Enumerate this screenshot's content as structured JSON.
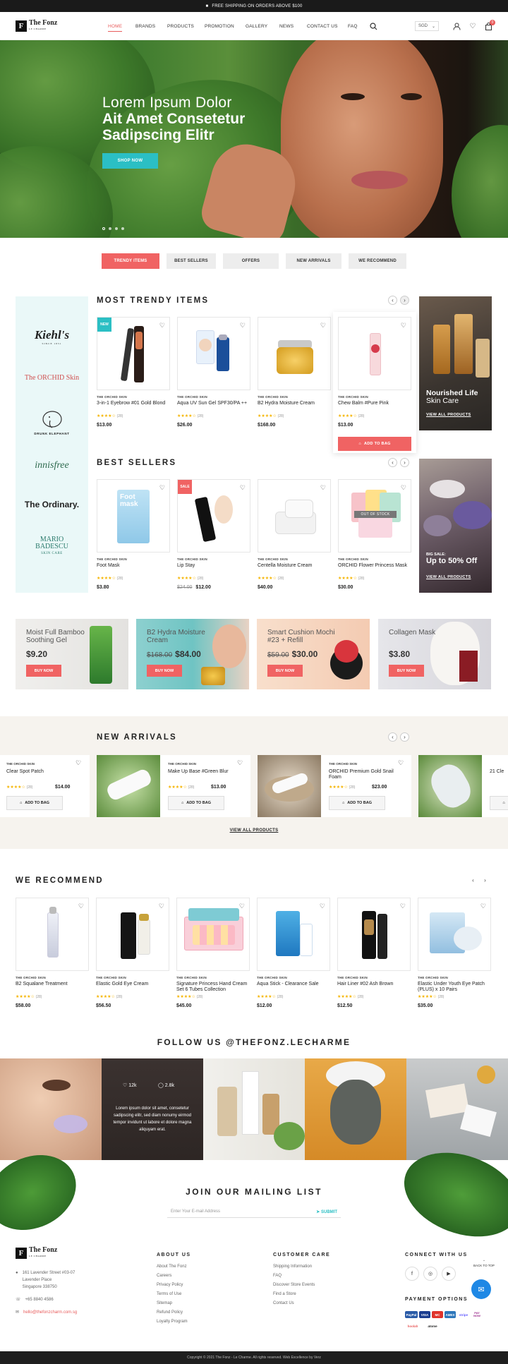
{
  "topbar": {
    "text": "FREE SHIPPING ON ORDERS ABOVE $100"
  },
  "logo": {
    "name": "The Fonz",
    "sub": "LE CHARME"
  },
  "nav": [
    "HOME",
    "BRANDS",
    "PRODUCTS",
    "PROMOTION",
    "GALLERY",
    "NEWS",
    "CONTACT US",
    "FAQ"
  ],
  "currency": "SGD",
  "cart_count": "0",
  "hero": {
    "line1": "Lorem Ipsum Dolor",
    "line2": "Ait Amet Consetetur",
    "line3": "Sadipscing Elitr",
    "button": "SHOP NOW"
  },
  "tabs": [
    "TRENDY ITEMS",
    "BEST SELLERS",
    "OFFERS",
    "NEW ARRIVALS",
    "WE RECOMMEND"
  ],
  "brands": [
    "Kiehl's",
    "The ORCHID Skin",
    "DRUNK ELEPHANT",
    "innisfree",
    "The Ordinary.",
    "MARIO BADESCU"
  ],
  "brand_subs": {
    "kiehls": "SINCE 1851",
    "mario": "SKIN CARE"
  },
  "trendy": {
    "title": "MOST TRENDY ITEMS",
    "items": [
      {
        "tag": "NEW",
        "brand": "THE ORCHID SKIN",
        "name": "3-in-1 Eyebrow #01 Gold Blond",
        "reviews": "(28)",
        "price": "$13.00"
      },
      {
        "brand": "THE ORCHID SKIN",
        "name": "Aqua UV Sun Gel SPF30/PA ++",
        "reviews": "(28)",
        "price": "$26.00"
      },
      {
        "brand": "THE ORCHID SKIN",
        "name": "B2 Hydra Moisture Cream",
        "reviews": "(28)",
        "price": "$168.00"
      },
      {
        "brand": "THE ORCHID SKIN",
        "name": "Chew Balm #Pure Pink",
        "reviews": "(28)",
        "price": "$13.00",
        "button": "ADD TO BAG"
      }
    ],
    "promo": {
      "l1": "Nourished Life",
      "l2": "Skin Care",
      "link": "VIEW ALL PRODUCTS"
    }
  },
  "bestsellers": {
    "title": "BEST SELLERS",
    "items": [
      {
        "brand": "THE ORCHID SKIN",
        "name": "Foot Mask",
        "reviews": "(28)",
        "price": "$3.80"
      },
      {
        "tag": "SALE",
        "brand": "THE ORCHID SKIN",
        "name": "Lip Stay",
        "reviews": "(28)",
        "old": "$24.00",
        "price": "$12.00"
      },
      {
        "brand": "THE ORCHID SKIN",
        "name": "Centella Moisture Cream",
        "reviews": "(28)",
        "price": "$40.00"
      },
      {
        "oos": "OUT OF STOCK",
        "brand": "THE ORCHID SKIN",
        "name": "ORCHID Flower Princess Mask",
        "reviews": "(28)",
        "price": "$30.00"
      }
    ],
    "promo": {
      "l1": "BIG SALE:",
      "l2": "Up to 50% Off",
      "link": "VIEW ALL PRODUCTS"
    }
  },
  "banners": [
    {
      "title": "Moist Full Bamboo Soothing Gel",
      "price": "$9.20",
      "button": "BUY NOW"
    },
    {
      "title": "B2 Hydra Moisture Cream",
      "old": "$168.00",
      "price": "$84.00",
      "button": "BUY NOW"
    },
    {
      "title": "Smart Cushion Mochi #23 + Refill",
      "old": "$59.00",
      "price": "$30.00",
      "button": "BUY NOW"
    },
    {
      "title": "Collagen Mask",
      "price": "$3.80",
      "button": "BUY NOW"
    }
  ],
  "newarrivals": {
    "title": "NEW ARRIVALS",
    "items": [
      {
        "brand": "THE ORCHID SKIN",
        "name": "Clear Spot Patch",
        "reviews": "(28)",
        "price": "$14.00",
        "button": "ADD TO BAG"
      },
      {
        "brand": "THE ORCHID SKIN",
        "name": "Make Up Base #Green Blur",
        "reviews": "(28)",
        "price": "$13.00",
        "button": "ADD TO BAG"
      },
      {
        "brand": "THE ORCHID SKIN",
        "name": "ORCHID Premium Gold Snail Foam",
        "reviews": "(28)",
        "price": "$23.00",
        "button": "ADD TO BAG"
      },
      {
        "name": "21 Cle"
      }
    ],
    "link": "VIEW ALL PRODUCTS"
  },
  "recommend": {
    "title": "WE RECOMMEND",
    "items": [
      {
        "brand": "THE ORCHID SKIN",
        "name": "B2 Squalane Treatment",
        "reviews": "(28)",
        "price": "$58.00"
      },
      {
        "brand": "THE ORCHID SKIN",
        "name": "Elastic Gold Eye Cream",
        "reviews": "(28)",
        "price": "$56.50"
      },
      {
        "brand": "THE ORCHID SKIN",
        "name": "Signature Princess Hand Cream Set 6 Tubes Collection",
        "reviews": "(28)",
        "price": "$45.00"
      },
      {
        "brand": "THE ORCHID SKIN",
        "name": "Aqua Stick - Clearance Sale",
        "reviews": "(28)",
        "price": "$12.00"
      },
      {
        "brand": "THE ORCHID SKIN",
        "name": "Hair Liner #02 Ash Brown",
        "reviews": "(28)",
        "price": "$12.50"
      },
      {
        "brand": "THE ORCHID SKIN",
        "name": "Elastic Under Youth Eye Patch (PLUS) x 10 Pairs",
        "reviews": "(28)",
        "price": "$35.00"
      }
    ]
  },
  "follow": {
    "title": "FOLLOW US @THEFONZ.LECHARME",
    "likes": "12k",
    "comments": "2.8k",
    "caption": "Lorem ipsum dolor sit amet, consetetur sadipscing elitr, sed diam nonumy eirmod tempor invidunt ut labore et dolore magna aliquyam erat."
  },
  "mailing": {
    "title": "JOIN OUR MAILING LIST",
    "placeholder": "Enter Your E-mail Address",
    "button": "SUBMIT"
  },
  "footer": {
    "address": [
      "161 Lavender Street #03-07",
      "Lavender Place",
      "Singapore 338750"
    ],
    "phone": "+65 8840 4586",
    "email": "hello@thefonzcharm.com.sg",
    "about_title": "ABOUT US",
    "about": [
      "About The Fonz",
      "Careers",
      "Privacy Policy",
      "Terms of Use",
      "Sitemap",
      "Refund Policy",
      "Loyalty Program"
    ],
    "care_title": "CUSTOMER CARE",
    "care": [
      "Shipping Information",
      "FAQ",
      "Discover Store Events",
      "Find a Store",
      "Contact Us"
    ],
    "connect_title": "CONNECT WITH US",
    "social": [
      "f",
      "◎",
      "▶"
    ],
    "payment_title": "PAYMENT OPTIONS",
    "payments": [
      "PayPal",
      "VISA",
      "MC",
      "AMEX",
      "stripe",
      "PAY NOW",
      "hoolah",
      "atome"
    ],
    "back_to_top": "BACK TO TOP",
    "copyright": "Copyright © 2021 The Fonz - Le Charme. All rights reserved. Web Excellence by Verz"
  }
}
